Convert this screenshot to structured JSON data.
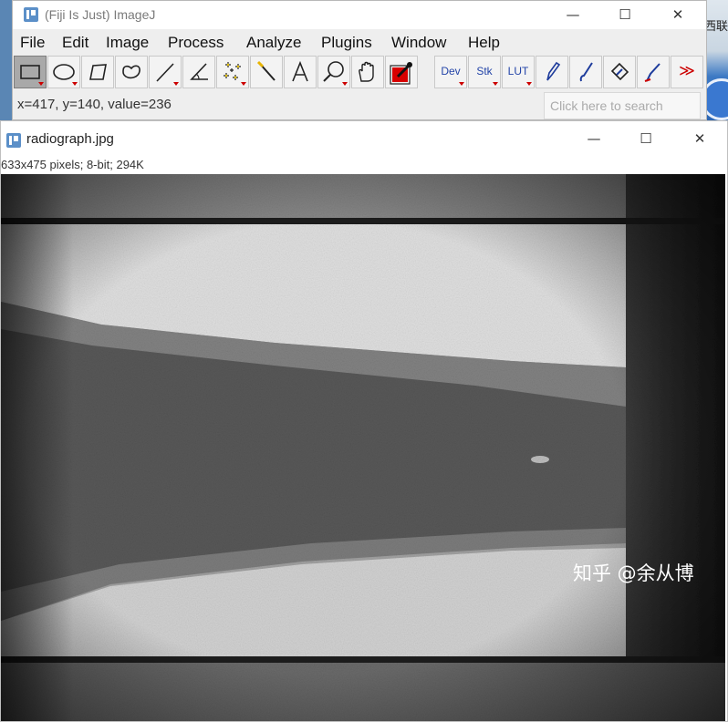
{
  "desktop": {
    "partial_text": "西联"
  },
  "ij": {
    "title": "(Fiji Is Just) ImageJ",
    "window_buttons": {
      "minimize": "—",
      "maximize": "☐",
      "close": "✕"
    },
    "menu": [
      "File",
      "Edit",
      "Image",
      "Process",
      "Analyze",
      "Plugins",
      "Window",
      "Help"
    ],
    "tools": [
      "rectangle",
      "oval",
      "polygon",
      "freehand",
      "straight-line",
      "angle",
      "multi-point",
      "wand",
      "text",
      "magnifier",
      "hand",
      "color-picker"
    ],
    "toolbar_text": {
      "dev": "Dev",
      "stk": "Stk",
      "lut": "LUT",
      "more": "≫"
    },
    "status": "x=417, y=140, value=236",
    "search_placeholder": "Click here to search"
  },
  "image_window": {
    "title": "radiograph.jpg",
    "info": "633x475 pixels; 8-bit; 294K",
    "window_buttons": {
      "minimize": "—",
      "maximize": "☐",
      "close": "✕"
    }
  },
  "watermark": "知乎 @余从博"
}
